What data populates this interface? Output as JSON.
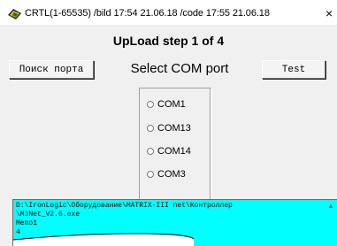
{
  "window": {
    "title": "CRTL(1-65535) /bild 17:54 21.06.18 /code 17:55 21.06.18",
    "app_icon": "app-logo-icon",
    "close_glyph": "×",
    "close_icon": "close-icon"
  },
  "dialog": {
    "step_title": "UpLoad step 1 of 4",
    "search_port_label": "Поиск порта",
    "select_port_heading": "Select COM port",
    "test_label": "Test",
    "ports": [
      {
        "label": "COM1",
        "selected": false
      },
      {
        "label": "COM13",
        "selected": false
      },
      {
        "label": "COM14",
        "selected": false
      },
      {
        "label": "COM3",
        "selected": false
      }
    ]
  },
  "memo": {
    "lines": [
      "D:\\IronLogic\\Оборудование\\MATRIX-III net\\Контроллер",
      "\\M3Net_V2.6.exe",
      "Memo1",
      "4"
    ],
    "background": "#00ffff",
    "scroll_up_glyph": "▲"
  },
  "colors": {
    "dialog_background": "#f0f0f0",
    "memo_background": "#00ffff"
  }
}
